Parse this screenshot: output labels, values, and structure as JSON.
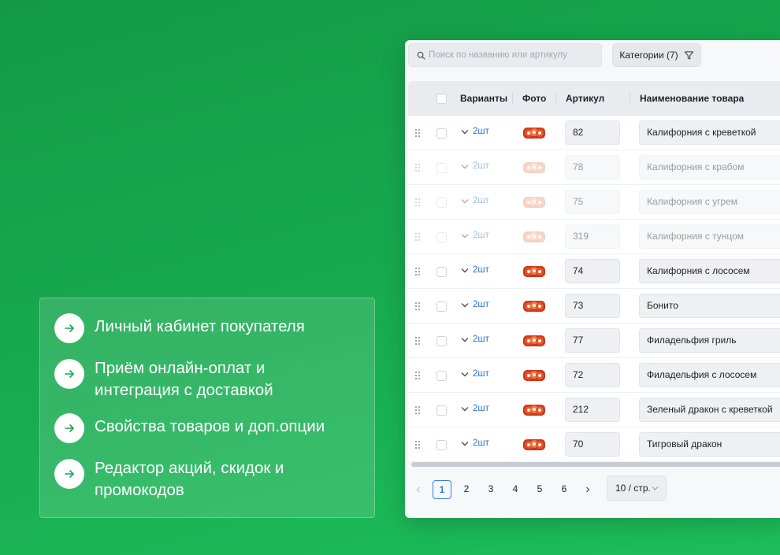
{
  "features": [
    {
      "text": "Личный кабинет покупателя",
      "icon": "arrow-right-icon"
    },
    {
      "text": "Приём онлайн-оплат и интеграция с доставкой",
      "icon": "arrow-right-icon"
    },
    {
      "text": "Свойства товаров и доп.опции",
      "icon": "arrow-right-icon"
    },
    {
      "text": "Редактор акций, скидок и промокодов",
      "icon": "arrow-right-icon"
    }
  ],
  "toolbar": {
    "search_placeholder": "Поиск по названию или артикулу",
    "categories_label": "Категории (7)"
  },
  "table": {
    "headers": {
      "variants": "Варианты",
      "photo": "Фото",
      "sku": "Артикул",
      "name": "Наименование товара"
    },
    "rows": [
      {
        "variants": "2шт",
        "sku": "82",
        "name": "Калифорния с креветкой",
        "dim": false
      },
      {
        "variants": "2шт",
        "sku": "78",
        "name": "Калифорния с крабом",
        "dim": true
      },
      {
        "variants": "2шт",
        "sku": "75",
        "name": "Калифорния с угрем",
        "dim": true
      },
      {
        "variants": "2шт",
        "sku": "319",
        "name": "Калифорния с тунцом",
        "dim": true
      },
      {
        "variants": "2шт",
        "sku": "74",
        "name": "Калифорния с лососем",
        "dim": false
      },
      {
        "variants": "2шт",
        "sku": "73",
        "name": "Бонито",
        "dim": false
      },
      {
        "variants": "2шт",
        "sku": "77",
        "name": "Филадельфия гриль",
        "dim": false
      },
      {
        "variants": "2шт",
        "sku": "72",
        "name": "Филадельфия с лососем",
        "dim": false
      },
      {
        "variants": "2шт",
        "sku": "212",
        "name": "Зеленый дракон с креветкой",
        "dim": false
      },
      {
        "variants": "2шт",
        "sku": "70",
        "name": "Тигровый дракон",
        "dim": false
      }
    ]
  },
  "pagination": {
    "pages": [
      "1",
      "2",
      "3",
      "4",
      "5",
      "6"
    ],
    "current": "1",
    "per_page": "10 / стр."
  },
  "colors": {
    "accent": "#2f7be5",
    "link": "#2c6fd6",
    "background_green": "#17a84f"
  }
}
